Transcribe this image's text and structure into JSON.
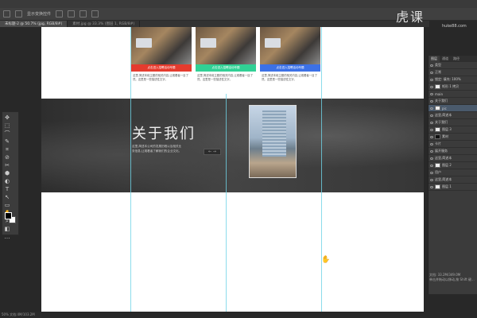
{
  "app": {
    "doc_tabs": [
      "未标题-2 @ 50.7% (jpg, RGB/8#)",
      "素材.jpg @ 33.3% (图层 1, RGB/8#)"
    ],
    "options_text": "显示变换控件",
    "watermark": "虎课",
    "watermark_url": "huke88.com",
    "status_zoom": "50% 文档:4M/103.2M"
  },
  "canvas": {
    "cards": [
      {
        "band_text": "点击进入招聘活动专题",
        "band_color": "#e53b2e",
        "desc": "这里,简述本段主题的相关内容,让观看者一目了然。这里是一些描述性文字。"
      },
      {
        "band_text": "点击进入招聘活动专题",
        "band_color": "#31d095",
        "desc": "这里,简述本段主题的相关内容,让观看者一目了然。这里是一些描述性文字。"
      },
      {
        "band_text": "点击进入招聘活动专题",
        "band_color": "#3c71e6",
        "desc": "这里,简述本段主题的相关内容,让观看者一目了然。这里是一些描述性文字。"
      }
    ],
    "about_title": "关于我们",
    "about_desc": "这里,简述本公司的发展历程以及相关业务信息,让观看者了解我们的企业文化。",
    "arrow_text": "← →"
  },
  "layers": {
    "tabs": [
      "图层",
      "通道",
      "路径"
    ],
    "rows": [
      {
        "name": "类型",
        "thumb": "none",
        "sel": false
      },
      {
        "name": "正常",
        "thumb": "none",
        "sel": false
      },
      {
        "name": "锁定: 填充: 100%",
        "thumb": "none",
        "sel": false
      },
      {
        "name": "矩形 1 拷贝",
        "thumb": "light",
        "sel": false
      },
      {
        "name": "main",
        "thumb": "none",
        "sel": false
      },
      {
        "name": "关于我们",
        "thumb": "none",
        "sel": false
      },
      {
        "name": "pic",
        "thumb": "light",
        "sel": true
      },
      {
        "name": "这里,简述本",
        "thumb": "none",
        "sel": false
      },
      {
        "name": "关于我们",
        "thumb": "none",
        "sel": false
      },
      {
        "name": "图层 3",
        "thumb": "light",
        "sel": false
      },
      {
        "name": "素材",
        "thumb": "dark",
        "sel": false
      },
      {
        "name": "卡片",
        "thumb": "none",
        "sel": false
      },
      {
        "name": "展开服务",
        "thumb": "none",
        "sel": false
      },
      {
        "name": "这里,简述本",
        "thumb": "none",
        "sel": false
      },
      {
        "name": "图层 2",
        "thumb": "light",
        "sel": false
      },
      {
        "name": "用户",
        "thumb": "none",
        "sel": false
      },
      {
        "name": "这里,简述本",
        "thumb": "none",
        "sel": false
      },
      {
        "name": "图层 1",
        "thumb": "light",
        "sel": false
      }
    ],
    "status_line1": "文档: 33.2M/349.0M",
    "status_line2": "单击并拖动以移动,按 Shift 键..."
  },
  "tools": [
    "✥",
    "⬚",
    "⌒",
    "✎",
    "⌗",
    "⊘",
    "✂",
    "⬢",
    "◐",
    "T",
    "↖",
    "▭",
    "✋",
    "⌕",
    "◧",
    "…"
  ]
}
